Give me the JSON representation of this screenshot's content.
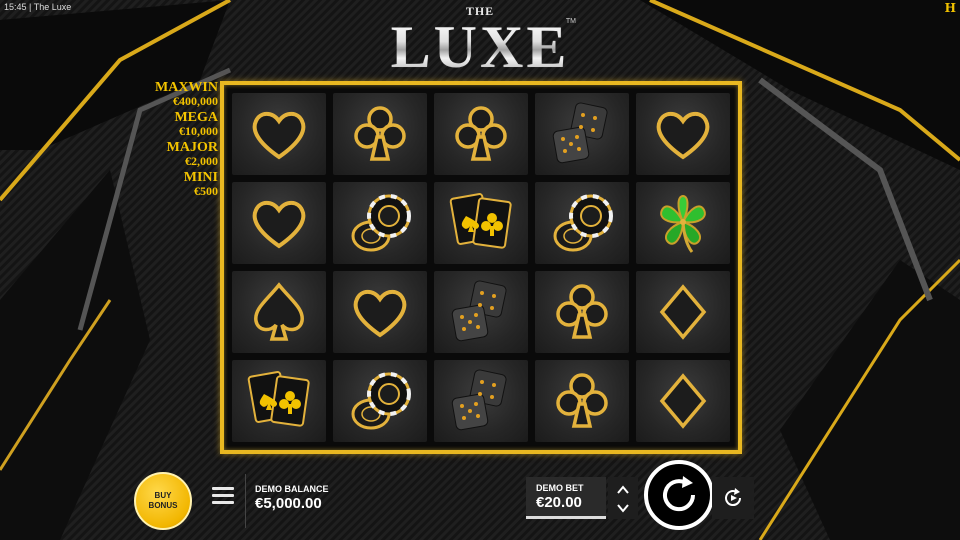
{
  "status": {
    "time": "15:45",
    "title": "The Luxe"
  },
  "brand_mark": "H",
  "logo": {
    "the": "THE",
    "luxe": "LUXE",
    "tm": "TM"
  },
  "jackpots": [
    {
      "name": "MAXWIN",
      "value": "€400,000"
    },
    {
      "name": "MEGA",
      "value": "€10,000"
    },
    {
      "name": "MAJOR",
      "value": "€2,000"
    },
    {
      "name": "MINI",
      "value": "€500"
    }
  ],
  "reels": [
    [
      "heart",
      "club",
      "club",
      "dice",
      "heart"
    ],
    [
      "heart",
      "chips",
      "cards",
      "chips",
      "clover"
    ],
    [
      "spade",
      "heart",
      "dice",
      "club",
      "diamond"
    ],
    [
      "cards",
      "chips",
      "dice",
      "club",
      "diamond"
    ]
  ],
  "controls": {
    "buy_bonus_line1": "BUY",
    "buy_bonus_line2": "BONUS",
    "balance_label": "DEMO BALANCE",
    "balance_value": "€5,000.00",
    "bet_label": "DEMO BET",
    "bet_value": "€20.00"
  },
  "colors": {
    "gold": "#e9b821",
    "jackpot": "#f4c400",
    "clover": "#2fbf2f"
  }
}
